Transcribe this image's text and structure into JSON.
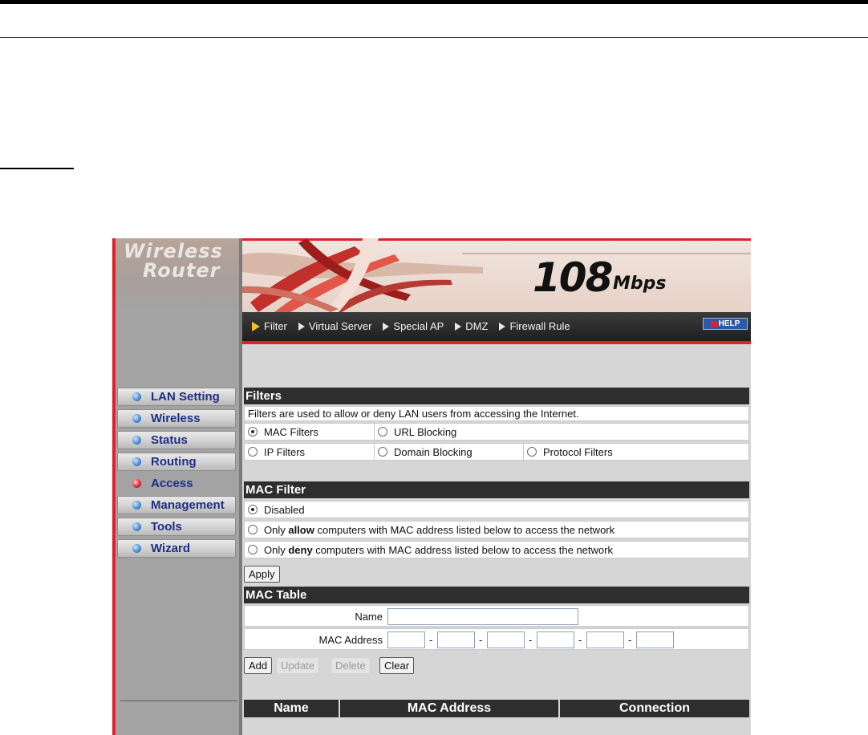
{
  "brand": {
    "line1": "Wireless",
    "line2": "Router"
  },
  "banner": {
    "speed_number": "108",
    "speed_unit": "Mbps"
  },
  "sidebar": {
    "items": [
      {
        "label": "LAN Setting",
        "active": false
      },
      {
        "label": "Wireless",
        "active": false
      },
      {
        "label": "Status",
        "active": false
      },
      {
        "label": "Routing",
        "active": false
      },
      {
        "label": "Access",
        "active": true
      },
      {
        "label": "Management",
        "active": false
      },
      {
        "label": "Tools",
        "active": false
      },
      {
        "label": "Wizard",
        "active": false
      }
    ]
  },
  "subnav": {
    "items": [
      "Filter",
      "Virtual Server",
      "Special AP",
      "DMZ",
      "Firewall Rule"
    ],
    "active": "Filter",
    "help_label": "HELP"
  },
  "filters": {
    "title": "Filters",
    "description": "Filters are used to allow or deny LAN users from accessing the Internet.",
    "options": {
      "mac": "MAC Filters",
      "url": "URL Blocking",
      "ip": "IP Filters",
      "domain": "Domain Blocking",
      "protocol": "Protocol Filters"
    },
    "selected": "MAC Filters"
  },
  "mac_filter": {
    "title": "MAC Filter",
    "disabled_label": "Disabled",
    "allow_prefix": "Only ",
    "allow_word": "allow",
    "allow_suffix": " computers with MAC address listed below to access the network",
    "deny_prefix": "Only ",
    "deny_word": "deny",
    "deny_suffix": " computers with MAC address listed below to access the network",
    "selected": "Disabled",
    "apply_label": "Apply"
  },
  "mac_table": {
    "title": "MAC Table",
    "name_label": "Name",
    "name_value": "",
    "mac_label": "MAC Address",
    "mac_values": [
      "",
      "",
      "",
      "",
      "",
      ""
    ],
    "separator": "-",
    "add_label": "Add",
    "update_label": "Update",
    "delete_label": "Delete",
    "clear_label": "Clear",
    "columns": [
      "Name",
      "MAC Address",
      "Connection"
    ]
  },
  "colors": {
    "accent_red": "#e0202a",
    "nav_text": "#1f2f86",
    "header_bg": "#2e2e2e"
  }
}
